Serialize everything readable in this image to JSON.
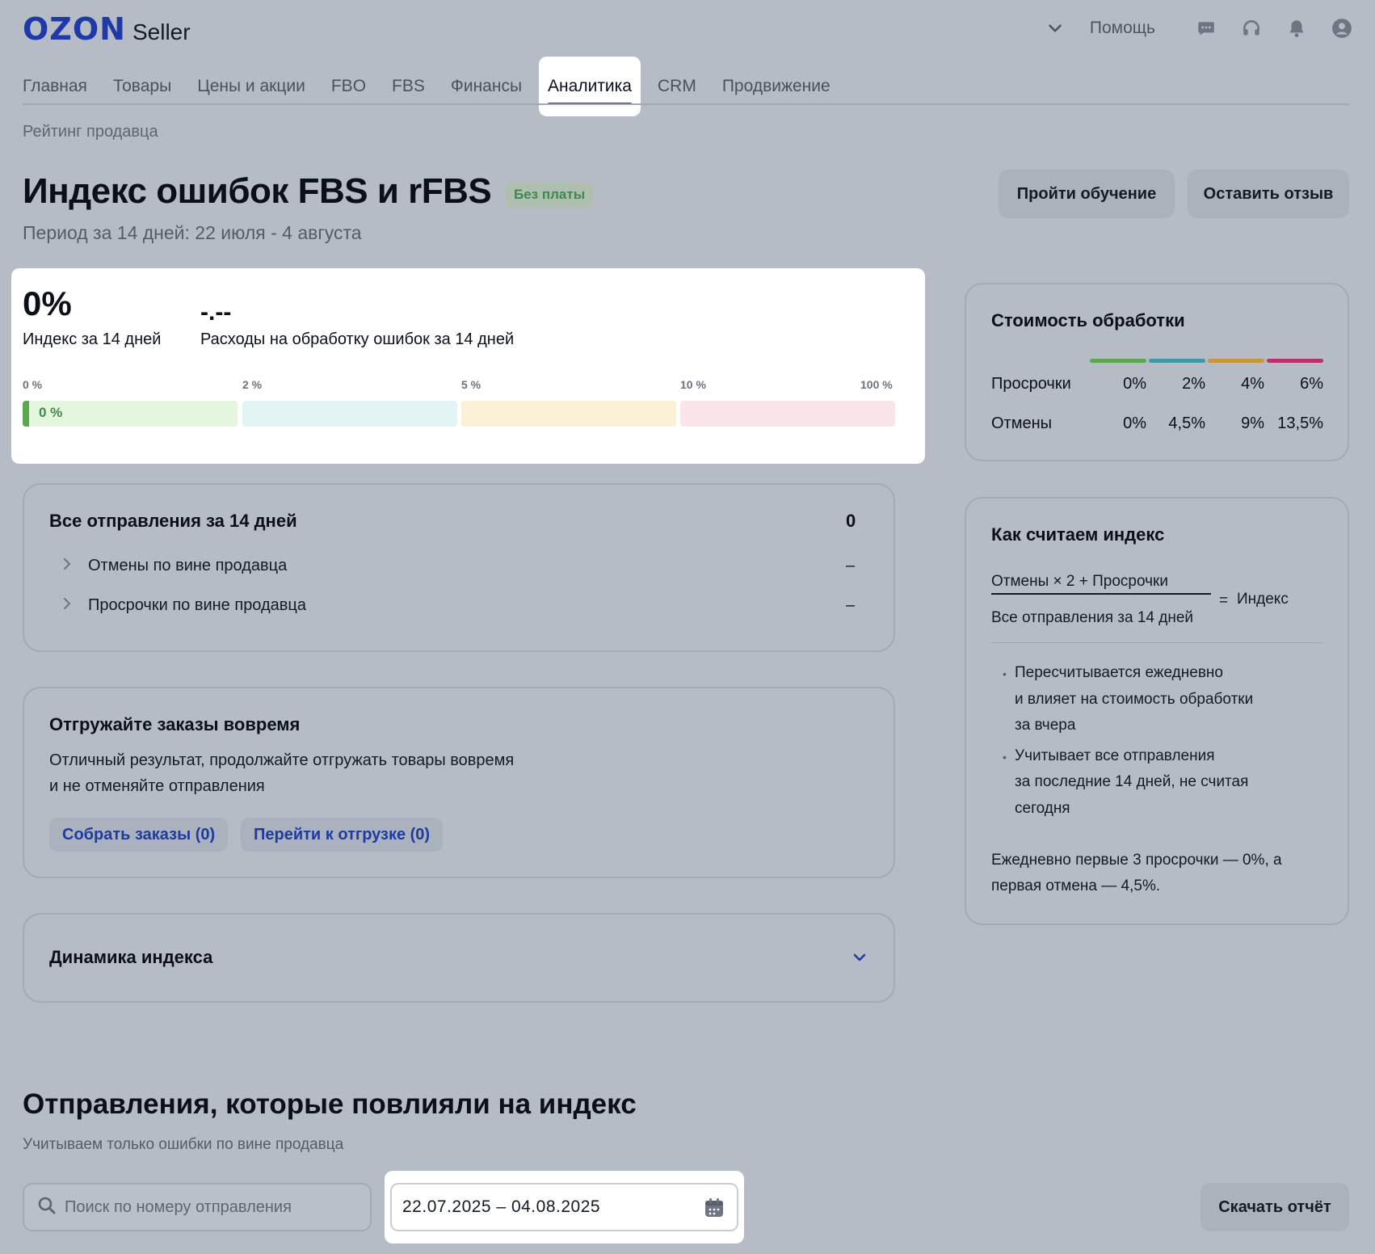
{
  "header": {
    "logo_ozon": "OZON",
    "logo_seller": "Seller",
    "help": "Помощь"
  },
  "nav": {
    "items": [
      "Главная",
      "Товары",
      "Цены и акции",
      "FBO",
      "FBS",
      "Финансы",
      "Аналитика",
      "CRM",
      "Продвижение"
    ],
    "active": "Аналитика"
  },
  "breadcrumb": "Рейтинг продавца",
  "page": {
    "title": "Индекс ошибок FBS и rFBS",
    "badge": "Без платы",
    "period": "Период за 14 дней: 22 июля - 4 августа",
    "learn_button": "Пройти обучение",
    "review_button": "Оставить отзыв"
  },
  "index_card": {
    "index_value": "0%",
    "index_label": "Индекс за 14 дней",
    "cost_value": "-.--",
    "cost_label": "Расходы на обработку ошибок за 14 дней",
    "scale_labels": [
      "0 %",
      "2 %",
      "5 %",
      "10 %",
      "100 %"
    ],
    "current_segment_label": "0 %",
    "current_value_percent": 0,
    "colors": {
      "green": "#5aa84f",
      "teal": "#3f9aa6",
      "orange": "#c9963a",
      "pink": "#b8306e"
    }
  },
  "shipments": {
    "title": "Все отправления за 14 дней",
    "total": "0",
    "rows": [
      {
        "label": "Отмены по вине продавца",
        "value": "–"
      },
      {
        "label": "Просрочки по вине продавца",
        "value": "–"
      }
    ]
  },
  "ontime": {
    "title": "Отгружайте заказы вовремя",
    "text_line1": "Отличный результат, продолжайте отгружать товары вовремя",
    "text_line2": "и не отменяйте отправления",
    "collect_button": "Собрать заказы (0)",
    "ship_button": "Перейти к отгрузке (0)"
  },
  "dynamics": {
    "title": "Динамика индекса"
  },
  "cost_card": {
    "title": "Стоимость обработки",
    "rows": [
      {
        "label": "Просрочки",
        "values": [
          "0%",
          "2%",
          "4%",
          "6%"
        ]
      },
      {
        "label": "Отмены",
        "values": [
          "0%",
          "4,5%",
          "9%",
          "13,5%"
        ]
      }
    ]
  },
  "calc_card": {
    "title": "Как считаем индекс",
    "numerator": "Отмены × 2 + Просрочки",
    "denominator": "Все отправления за 14 дней",
    "equals": "=",
    "result": "Индекс",
    "bullet1": [
      "Пересчитывается ежедневно",
      "и влияет на стоимость обработки",
      "за вчера"
    ],
    "bullet2": [
      "Учитывает все отправления",
      "за последние 14 дней, не считая",
      "сегодня"
    ],
    "note_line1": "Ежедневно первые 3 просрочки — 0%, а",
    "note_line2": "первая отмена — 4,5%."
  },
  "affected": {
    "title": "Отправления, которые повлияли на индекс",
    "subtitle": "Учитываем только ошибки по вине продавца",
    "search_placeholder": "Поиск по номеру отправления",
    "date_range": "22.07.2025 – 04.08.2025",
    "download_button": "Скачать отчёт"
  }
}
